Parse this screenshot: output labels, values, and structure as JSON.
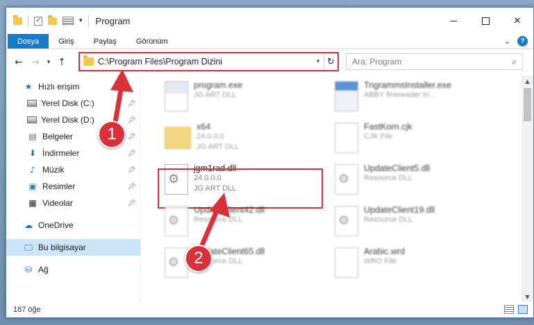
{
  "window": {
    "title": "Program"
  },
  "ribbon": {
    "tabs": [
      "Dosya",
      "Giriş",
      "Paylaş",
      "Görünüm"
    ]
  },
  "address": {
    "path": "C:\\Program Files\\Program Dizini"
  },
  "search": {
    "placeholder": "Ara: Program"
  },
  "sidebar": {
    "items": [
      {
        "label": "Hızlı erişim"
      },
      {
        "label": "Yerel Disk (C:)"
      },
      {
        "label": "Yerel Disk (D:)"
      },
      {
        "label": "Belgeler"
      },
      {
        "label": "İndirmeler"
      },
      {
        "label": "Müzik"
      },
      {
        "label": "Resimler"
      },
      {
        "label": "Videolar"
      },
      {
        "label": "OneDrive"
      },
      {
        "label": "Bu bilgisayar"
      },
      {
        "label": "Ağ"
      }
    ]
  },
  "files": [
    {
      "name": "program.exe",
      "line1": "JG ART DLL",
      "line2": "",
      "icon": "exe-icon"
    },
    {
      "name": "TrigrammsInstaller.exe",
      "line1": "ABBY finereader tri...",
      "line2": "",
      "icon": "app-icon"
    },
    {
      "name": "x64",
      "line1": "24.0.0.0",
      "line2": "JG ART DLL",
      "icon": "folder-icon"
    },
    {
      "name": "FastKorn.cjk",
      "line1": "CJK File",
      "line2": "",
      "icon": "file-icon"
    },
    {
      "name": "jgm1rad.dll",
      "line1": "24.0.0.0",
      "line2": "JG ART DLL",
      "icon": "dll-icon"
    },
    {
      "name": "UpdateClient5.dll",
      "line1": "Resource DLL",
      "line2": "",
      "icon": "dll-icon"
    },
    {
      "name": "UpdateClient42.dll",
      "line1": "Resource DLL",
      "line2": "",
      "icon": "dll-icon"
    },
    {
      "name": "UpdateClient19.dll",
      "line1": "Resource DLL",
      "line2": "",
      "icon": "dll-icon"
    },
    {
      "name": "UpdateClient65.dll",
      "line1": "Resource DLL",
      "line2": "",
      "icon": "dll-icon"
    },
    {
      "name": "Arabic.wrd",
      "line1": "WRD File",
      "line2": "",
      "icon": "file-icon"
    }
  ],
  "status": {
    "count": "187 öğe"
  },
  "callouts": {
    "one": "1",
    "two": "2"
  },
  "colors": {
    "accent": "#1979ca",
    "highlight": "#d9313c",
    "selection": "#cce4f7"
  }
}
